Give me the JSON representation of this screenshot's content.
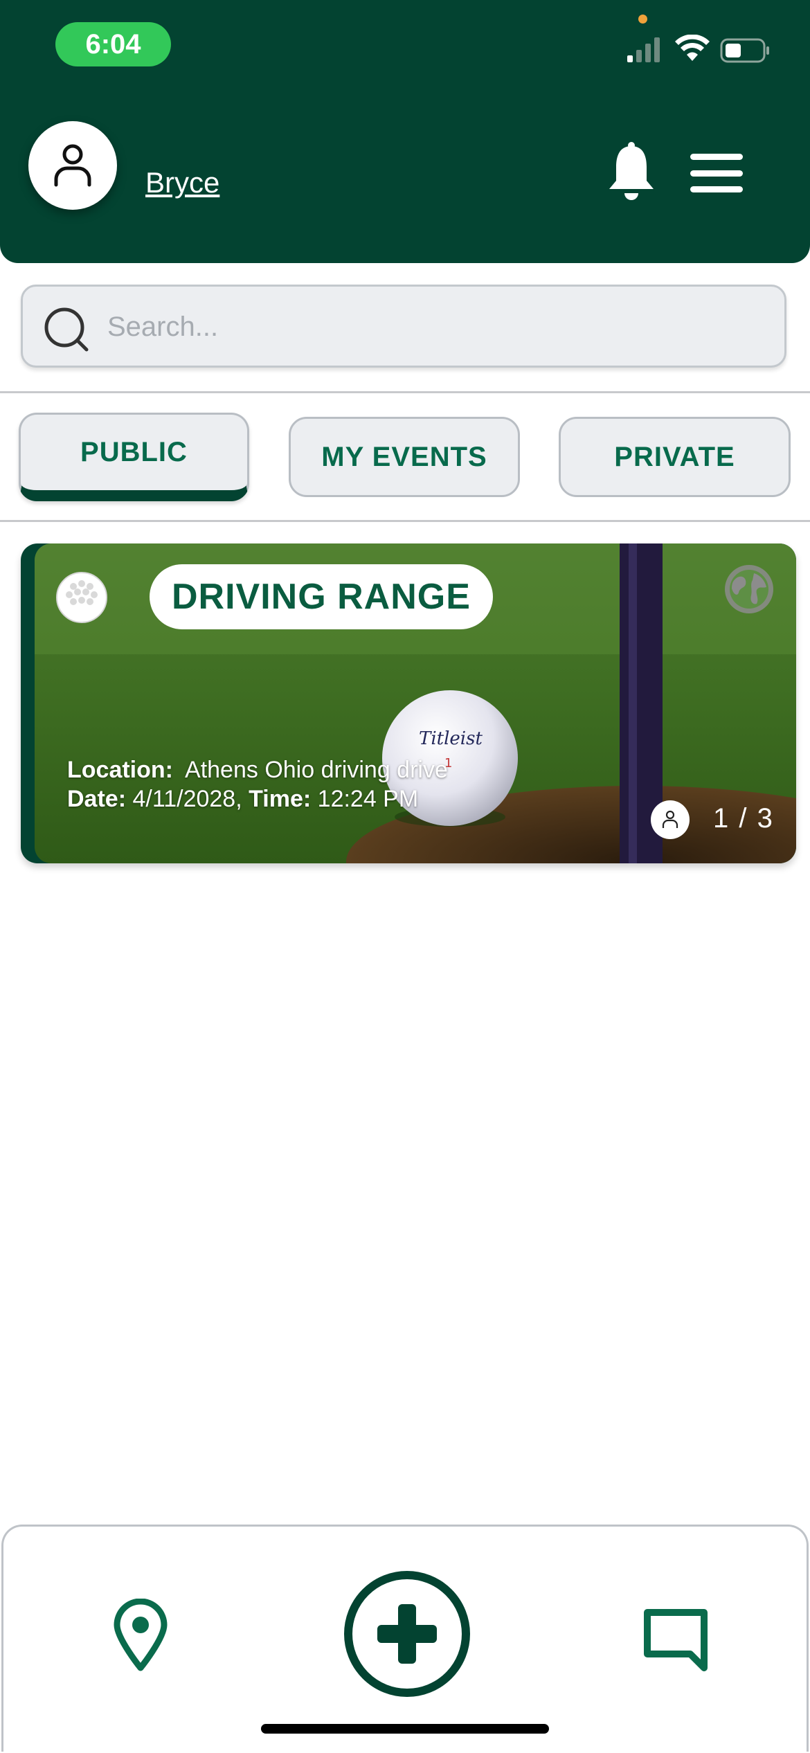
{
  "status_bar": {
    "time": "6:04"
  },
  "header": {
    "username": "Bryce"
  },
  "search": {
    "placeholder": "Search..."
  },
  "tabs": [
    {
      "label": "PUBLIC",
      "active": true
    },
    {
      "label": "MY EVENTS",
      "active": false
    },
    {
      "label": "PRIVATE",
      "active": false
    }
  ],
  "events": [
    {
      "title": "DRIVING RANGE",
      "location_label": "Location:",
      "location": "Athens Ohio driving drive",
      "date_label": "Date:",
      "date": "4/11/2028,",
      "time_label": "Time:",
      "time": "12:24 PM",
      "attendees": "1 / 3",
      "visibility_icon": "globe-icon",
      "type_icon": "golf-ball-icon"
    }
  ],
  "bottom_nav": {
    "items": [
      "location-pin-icon",
      "add-event-icon",
      "chat-icon"
    ]
  },
  "colors": {
    "primary": "#034331",
    "accent": "#086a4c",
    "status_pill": "#32c859"
  }
}
